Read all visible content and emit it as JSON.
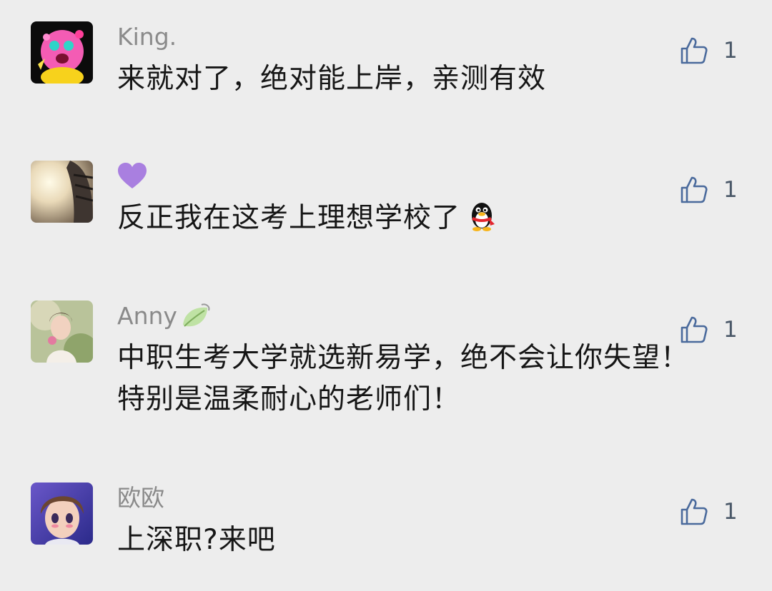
{
  "comments": [
    {
      "nickname": "King.",
      "text": "来就对了，绝对能上岸，亲测有效",
      "likes": "1",
      "avatar": "pink-kirby-avatar"
    },
    {
      "nickname": "",
      "nickname_emoji": "purple-heart-icon",
      "text": "反正我在这考上理想学校了",
      "text_emoji": "penguin-icon",
      "likes": "1",
      "avatar": "sunlit-photo-avatar"
    },
    {
      "nickname": "Anny",
      "nickname_emoji": "leaf-icon",
      "text": "中职生考大学就选新易学，绝不会让你失望！特别是温柔耐心的老师们！",
      "likes": "1",
      "avatar": "girl-photo-avatar"
    },
    {
      "nickname": "欧欧",
      "text": "上深职?来吧",
      "likes": "1",
      "avatar": "anime-boy-avatar"
    }
  ],
  "colors": {
    "background": "#ededed",
    "nickname": "#8a8a8a",
    "text": "#161616",
    "like_icon": "#4a6a9c"
  }
}
